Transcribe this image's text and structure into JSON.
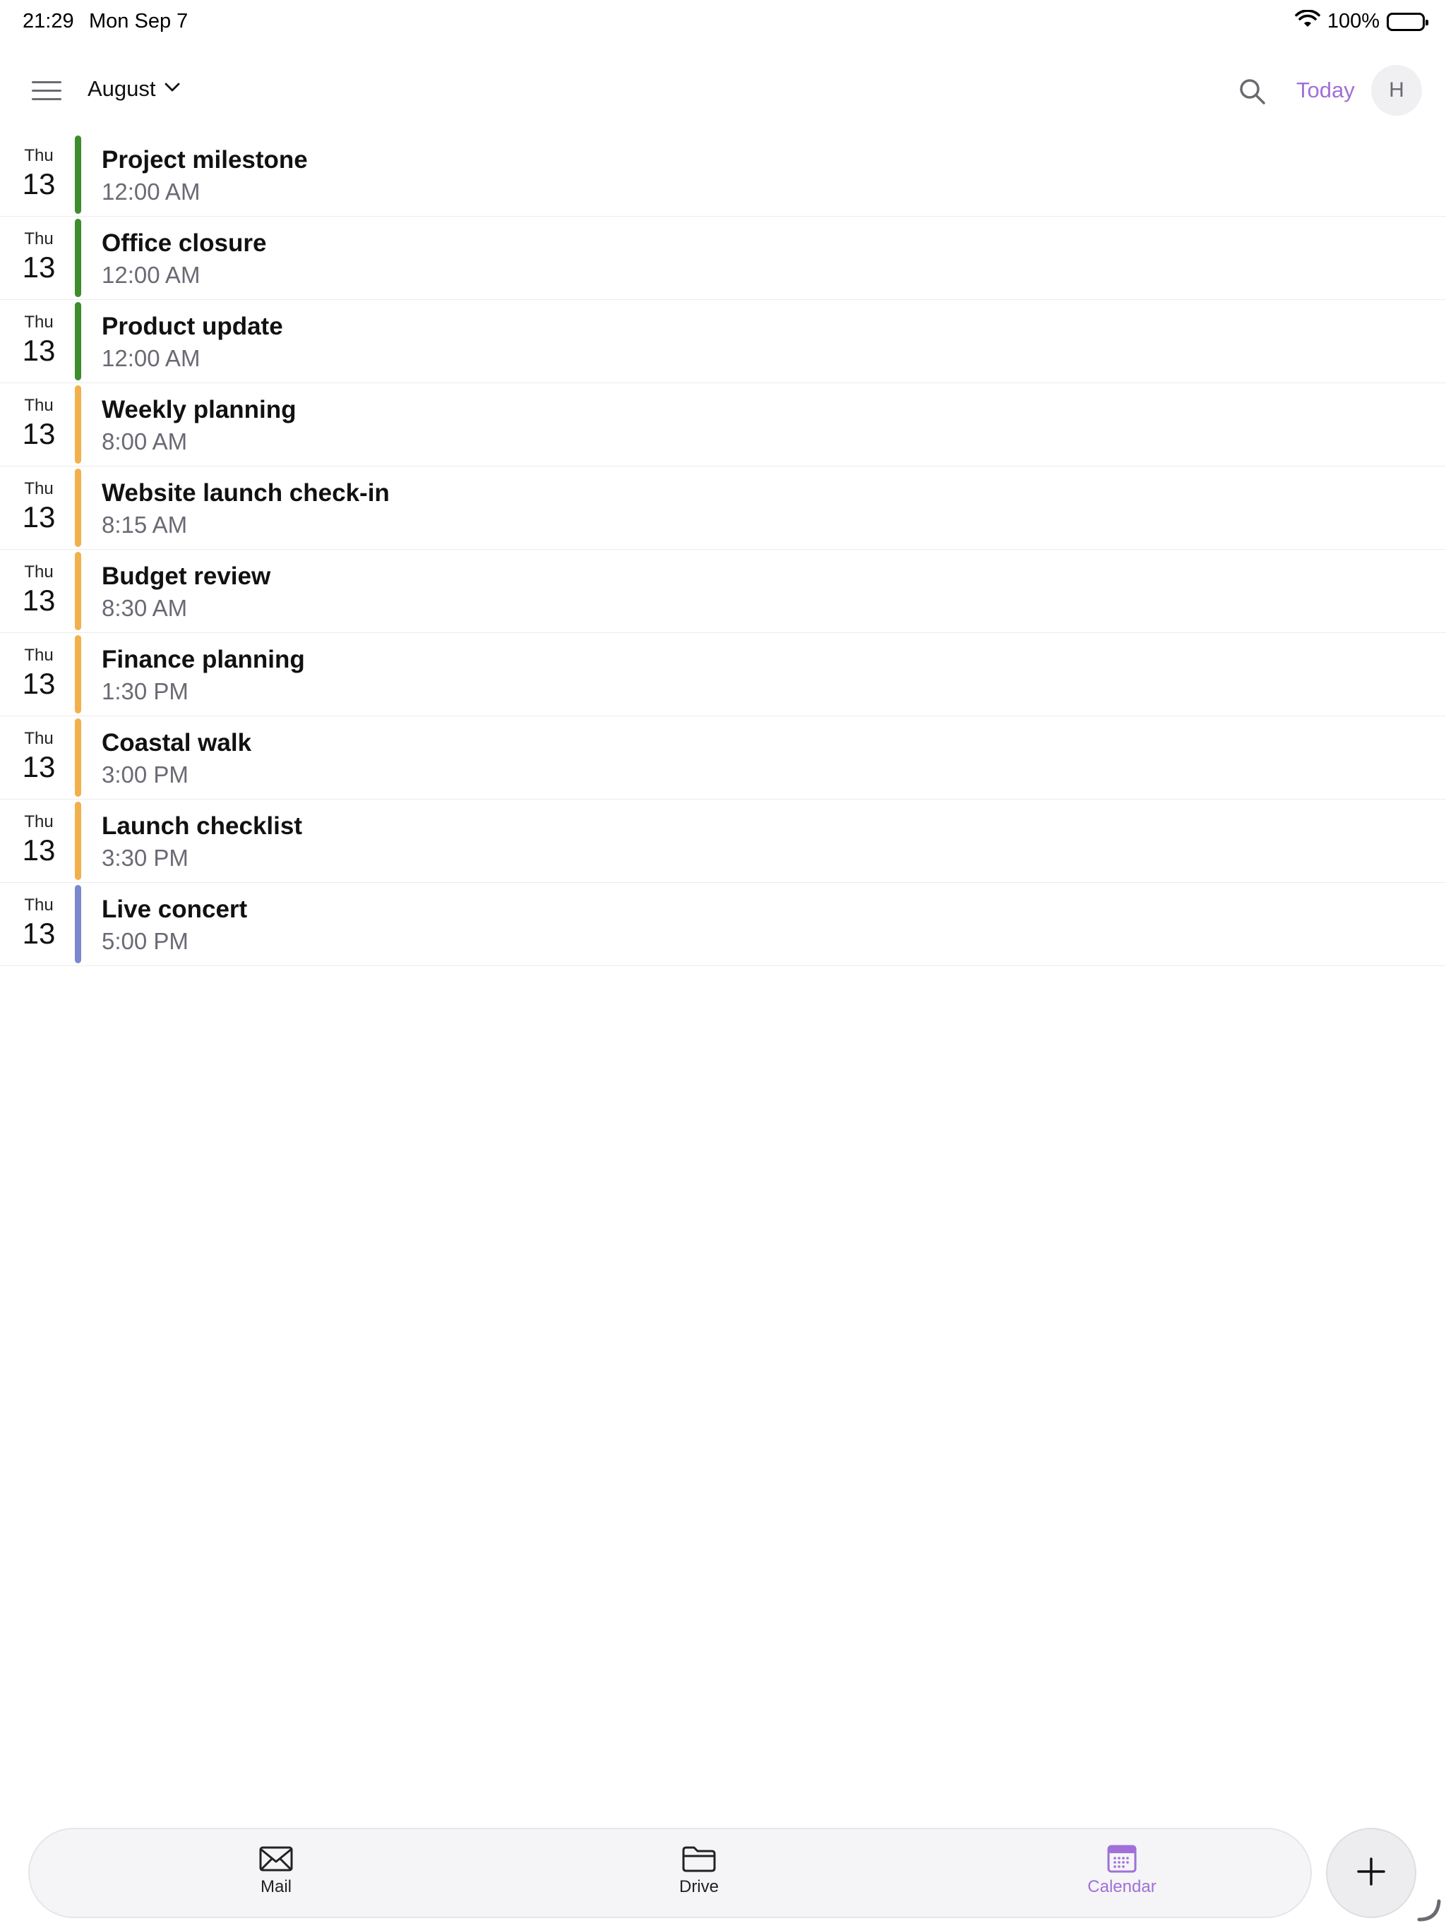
{
  "status_bar": {
    "time": "21:29",
    "date": "Mon Sep 7",
    "battery": "100%"
  },
  "header": {
    "month": "August",
    "today_label": "Today",
    "avatar_initial": "H"
  },
  "colors": {
    "green": "#3d8c2d",
    "orange": "#f2b04c",
    "blue": "#7b88cf",
    "accent": "#a070d8"
  },
  "events": [
    {
      "weekday": "Thu",
      "day": "13",
      "title": "Project milestone",
      "time": "12:00 AM",
      "color": "#3d8c2d"
    },
    {
      "weekday": "Thu",
      "day": "13",
      "title": "Office closure",
      "time": "12:00 AM",
      "color": "#3d8c2d"
    },
    {
      "weekday": "Thu",
      "day": "13",
      "title": "Product update",
      "time": "12:00 AM",
      "color": "#3d8c2d"
    },
    {
      "weekday": "Thu",
      "day": "13",
      "title": "Weekly planning",
      "time": "8:00 AM",
      "color": "#f2b04c"
    },
    {
      "weekday": "Thu",
      "day": "13",
      "title": "Website launch check-in",
      "time": "8:15 AM",
      "color": "#f2b04c"
    },
    {
      "weekday": "Thu",
      "day": "13",
      "title": "Budget review",
      "time": "8:30 AM",
      "color": "#f2b04c"
    },
    {
      "weekday": "Thu",
      "day": "13",
      "title": "Finance planning",
      "time": "1:30 PM",
      "color": "#f2b04c"
    },
    {
      "weekday": "Thu",
      "day": "13",
      "title": "Coastal walk",
      "time": "3:00 PM",
      "color": "#f2b04c"
    },
    {
      "weekday": "Thu",
      "day": "13",
      "title": "Launch checklist",
      "time": "3:30 PM",
      "color": "#f2b04c"
    },
    {
      "weekday": "Thu",
      "day": "13",
      "title": "Live concert",
      "time": "5:00 PM",
      "color": "#7b88cf"
    }
  ],
  "tab_bar": {
    "mail": {
      "label": "Mail",
      "icon": "mail-icon"
    },
    "drive": {
      "label": "Drive",
      "icon": "folder-icon"
    },
    "calendar": {
      "label": "Calendar",
      "icon": "calendar-icon",
      "active": true
    }
  },
  "fab": {
    "icon": "plus-icon"
  }
}
